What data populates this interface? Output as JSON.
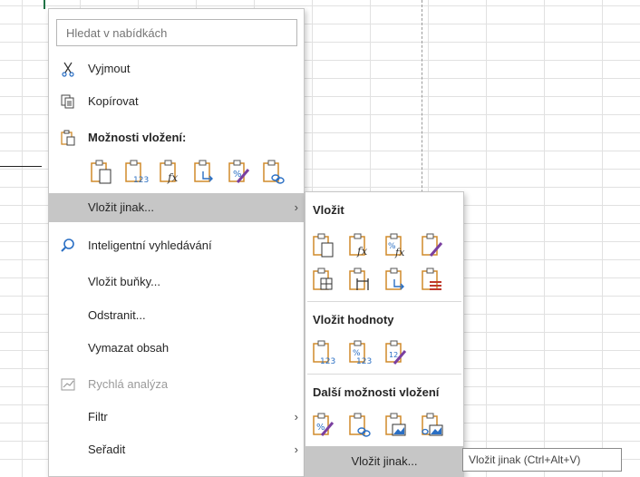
{
  "search": {
    "placeholder": "Hledat v nabídkách"
  },
  "menu": {
    "cut": "Vyjmout",
    "copy": "Kopírovat",
    "paste_options": "Možnosti vložení:",
    "paste_special": "Vložit jinak...",
    "smart_lookup": "Inteligentní vyhledávání",
    "insert_cells": "Vložit buňky...",
    "delete": "Odstranit...",
    "clear_contents": "Vymazat obsah",
    "quick_analysis": "Rychlá analýza",
    "filter": "Filtr",
    "sort": "Seřadit"
  },
  "submenu": {
    "paste_header": "Vložit",
    "paste_values_header": "Vložit hodnoty",
    "other_paste_header": "Další možnosti vložení",
    "paste_special_item": "Vložit jinak..."
  },
  "tooltip": "Vložit jinak (Ctrl+Alt+V)",
  "colors": {
    "clipboard_orange": "#d08a2a",
    "accent_blue": "#2a6fc4",
    "highlight": "#c6c6c6"
  }
}
